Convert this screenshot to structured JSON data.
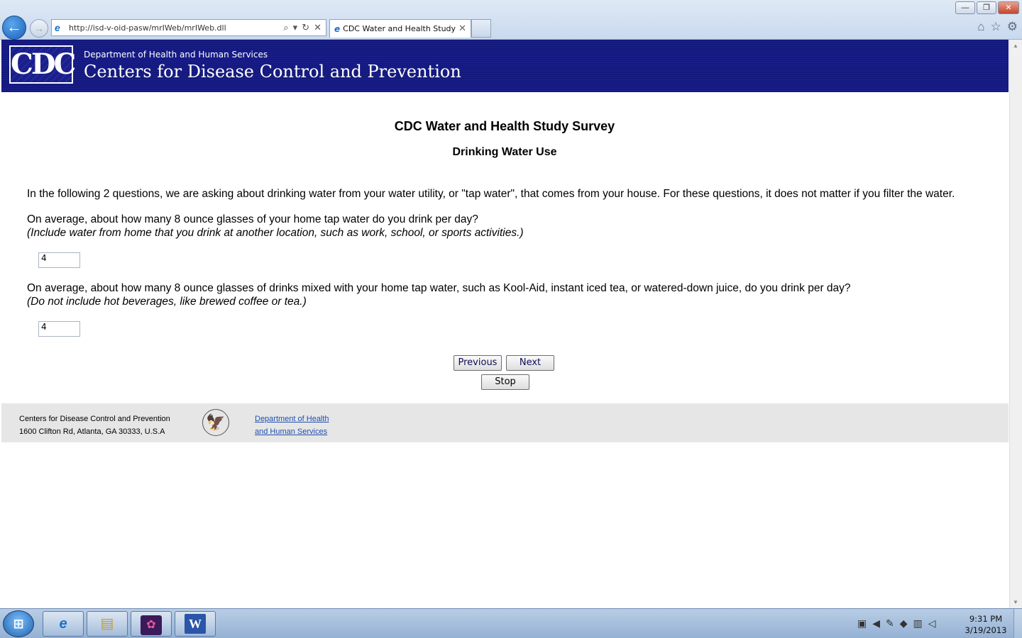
{
  "browser": {
    "url": "http://isd-v-oid-pasw/mrIWeb/mrIWeb.dll",
    "tab_title": "CDC Water and Health Study",
    "win_minimize": "—",
    "win_restore": "❐",
    "win_close": "✕",
    "back_glyph": "←",
    "fwd_glyph": "→",
    "icons": [
      "home-icon",
      "star-icon",
      "gear-icon"
    ]
  },
  "banner": {
    "logo_text": "CDC",
    "dept": "Department of Health and Human Services",
    "name": "Centers for Disease Control and Prevention"
  },
  "survey": {
    "title": "CDC Water and Health Study Survey",
    "section": "Drinking Water Use",
    "intro": "In the following 2 questions, we are asking about drinking water from your water utility, or \"tap water\", that comes from your house. For these questions, it does not matter if you filter the water.",
    "questions": [
      {
        "text": "On average, about how many 8 ounce glasses of your home tap water do you drink per day?",
        "note": "(Include water from home that you drink at another location, such as work, school, or sports activities.)",
        "answer": "4"
      },
      {
        "text": "On average, about how many 8 ounce glasses of drinks mixed with your home tap water, such as Kool-Aid, instant iced tea, or watered-down juice, do you drink per day?",
        "note": "(Do not include hot beverages, like brewed coffee or tea.)",
        "answer": "4"
      }
    ],
    "buttons": {
      "previous": "Previous",
      "next": "Next",
      "stop": "Stop"
    }
  },
  "footer": {
    "org_line1": "Centers for Disease Control and Prevention",
    "org_line2": "1600 Clifton Rd, Atlanta, GA 30333, U.S.A",
    "link_line1": "Department of Health",
    "link_line2": "and Human Services"
  },
  "taskbar": {
    "time": "9:31 PM",
    "date": "3/19/2013"
  }
}
